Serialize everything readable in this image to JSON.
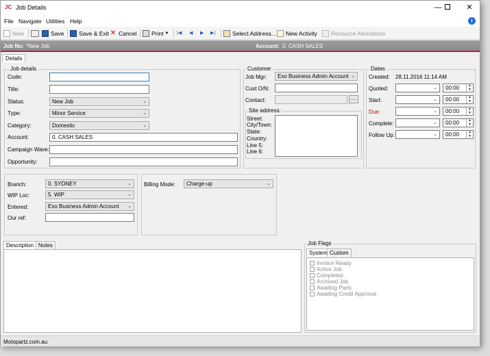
{
  "window": {
    "logo": "JC",
    "title": "Job Details"
  },
  "menu": [
    "File",
    "Navigate",
    "Utilities",
    "Help"
  ],
  "toolbar": {
    "new": "New",
    "save": "Save",
    "save_exit": "Save & Exit",
    "cancel": "Cancel",
    "print": "Print",
    "select_address": "Select Address...",
    "new_activity": "New Activity",
    "resource_allocations": "Resource Allocations"
  },
  "jobbar": {
    "job_no_label": "Job No:",
    "job_no_value": "*New Job",
    "account_label": "Account:",
    "account_value": "0. CASH SALES"
  },
  "details_tab": "Details",
  "job_details": {
    "legend": "Job details",
    "code_label": "Code:",
    "code_value": "",
    "title_label": "Title:",
    "title_value": "",
    "status_label": "Status:",
    "status_value": "New Job",
    "type_label": "Type:",
    "type_value": "Minor Service",
    "category_label": "Category:",
    "category_value": "Domestic",
    "account_label": "Account:",
    "account_value": "0. CASH SALES",
    "campaign_label": "Campaign Wave:",
    "campaign_value": "",
    "opportunity_label": "Opportunity:",
    "opportunity_value": ""
  },
  "customer": {
    "legend": "Customer",
    "job_mgr_label": "Job Mgr:",
    "job_mgr_value": "Exo Business Admin Account",
    "cust_on_label": "Cust O/N:",
    "cust_on_value": "",
    "contact_label": "Contact:",
    "contact_value": "",
    "site_legend": "Site address:",
    "site_lines": [
      "Street:",
      "City/Town:",
      "State:",
      "Country:",
      "Line 5:",
      "Line 6:"
    ]
  },
  "dates": {
    "legend": "Dates",
    "created_label": "Created:",
    "created_value": "28.11.2016  11:14 AM",
    "quoted_label": "Quoted:",
    "start_label": "Start:",
    "due_label": "Due:",
    "complete_label": "Complete:",
    "followup_label": "Follow Up:",
    "time_value": "00:00"
  },
  "location": {
    "branch_label": "Branch:",
    "branch_value": "0. SYDNEY",
    "wip_label": "WIP Loc:",
    "wip_value": "5. WIP",
    "entered_label": "Entered:",
    "entered_value": "Exo Business Admin Account",
    "ourref_label": "Our ref:",
    "ourref_value": ""
  },
  "billing": {
    "mode_label": "Billing Mode:",
    "mode_value": "Charge-up"
  },
  "notes_tabs": {
    "description": "Description",
    "notes": "Notes"
  },
  "job_flags": {
    "legend": "Job Flags",
    "tab_system": "System",
    "tab_custom": "Custom",
    "flags": [
      "Invoice Ready",
      "Active Job",
      "Completed",
      "Archived Job",
      "Awaiting Parts",
      "Awaiting Credit Approval"
    ]
  },
  "status_bar": "Motopartz.com.au"
}
